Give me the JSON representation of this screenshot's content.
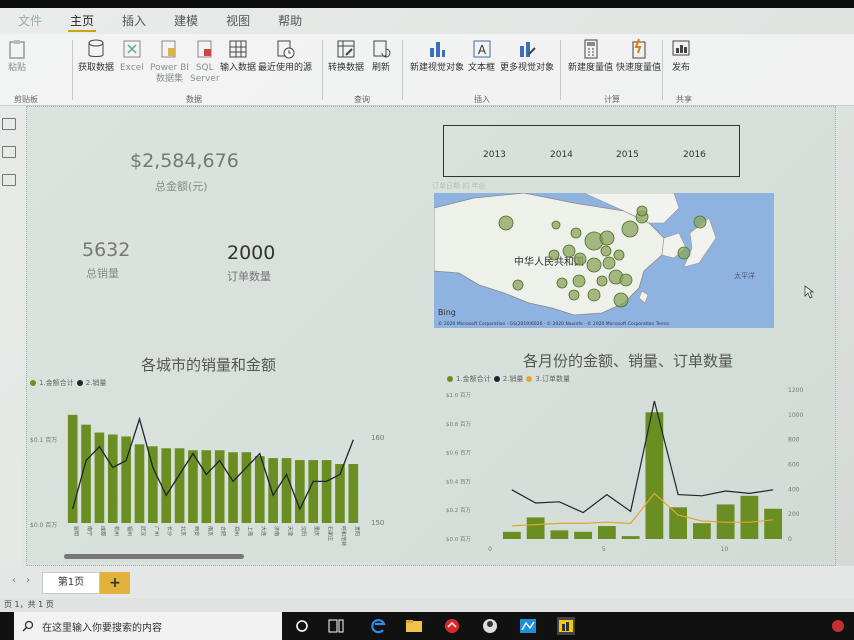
{
  "ribbon": {
    "tabs": [
      "文件",
      "主页",
      "插入",
      "建模",
      "视图",
      "帮助"
    ],
    "active_tab": "主页",
    "buttons": {
      "paste": "粘贴",
      "get_data": "获取数据",
      "excel": "Excel",
      "powerbi": "Power BI\n数据集",
      "sql": "SQL\nServer",
      "enter_data": "输入数据",
      "recent": "最近使用的源",
      "transform": "转换数据",
      "refresh": "刷新",
      "new_visual": "新建视觉对象",
      "textbox": "文本框",
      "more_visuals": "更多视觉对象",
      "new_measure": "新建度量值",
      "quick_measure": "快速度量值",
      "publish": "发布"
    },
    "groups": [
      "剪贴板",
      "数据",
      "查询",
      "插入",
      "计算",
      "共享"
    ]
  },
  "kpis": {
    "amount_value": "$2,584,676",
    "amount_label": "总金额(元)",
    "sales_value": "5632",
    "sales_label": "总销量",
    "orders_value": "2000",
    "orders_label": "订单数量"
  },
  "slicer": {
    "caption": "订单日期 的 年份",
    "years": [
      "2013",
      "2014",
      "2015",
      "2016"
    ]
  },
  "map": {
    "country_label": "中华人民共和国",
    "sea_label": "太平洋",
    "provider": "Bing",
    "copyright": "© 2020 Microsoft Corporation · GS(2019)6026 · © 2020 Navinfo · © 2020 Microsoft Corporation  Terms"
  },
  "left_chart_title": "各城市的销量和金额",
  "right_chart_title": "各月份的金额、销量、订单数量",
  "chart_data": [
    {
      "type": "bar",
      "title": "各城市的销量和金额",
      "series": [
        {
          "name": "1.金额合计",
          "values": [
            0.55,
            0.5,
            0.46,
            0.45,
            0.44,
            0.4,
            0.39,
            0.38,
            0.38,
            0.37,
            0.37,
            0.37,
            0.36,
            0.36,
            0.34,
            0.33,
            0.33,
            0.32,
            0.32,
            0.32,
            0.3,
            0.3
          ]
        },
        {
          "name": "2.销量",
          "values": [
            150,
            157,
            159,
            156,
            157,
            163,
            156,
            152,
            155,
            158,
            155,
            157,
            154,
            156,
            158,
            152,
            155,
            150,
            154,
            154,
            155,
            160
          ]
        }
      ],
      "y_ticks_left": [
        "$0.1 百万",
        "$0.0 百万"
      ],
      "y_ticks_right": [
        "160",
        "150"
      ],
      "city_labels": [
        "昆明",
        "南宁",
        "成都",
        "杭州",
        "福州",
        "武汉",
        "广州",
        "长沙",
        "北京",
        "西安",
        "南京",
        "合肥",
        "郑州",
        "上海",
        "大连",
        "济南",
        "天津",
        "沈阳",
        "重庆",
        "石家庄",
        "呼和浩特",
        "贵阳"
      ]
    },
    {
      "type": "bar",
      "title": "各月份的金额、销量、订单数量",
      "x": [
        1,
        2,
        3,
        4,
        5,
        6,
        7,
        8,
        9,
        10,
        11,
        12
      ],
      "series": [
        {
          "name": "1.金额合计",
          "values": [
            0.05,
            0.15,
            0.06,
            0.05,
            0.09,
            0.02,
            0.88,
            0.22,
            0.11,
            0.24,
            0.3,
            0.21
          ]
        },
        {
          "name": "2.销量",
          "values": [
            410,
            300,
            310,
            220,
            370,
            230,
            1150,
            370,
            360,
            400,
            380,
            410
          ]
        },
        {
          "name": "3.订单数量",
          "values": [
            110,
            120,
            130,
            130,
            140,
            130,
            380,
            200,
            150,
            140,
            140,
            160
          ]
        }
      ],
      "y_ticks_left": [
        "$1.0 百万",
        "$0.8 百万",
        "$0.6 百万",
        "$0.4 百万",
        "$0.2 百万",
        "$0.0 百万"
      ],
      "y_ticks_right": [
        "1200",
        "1000",
        "800",
        "600",
        "400",
        "200",
        "0"
      ],
      "x_ticks": [
        "0",
        "5",
        "10"
      ],
      "ylim_left": [
        0,
        1.0
      ],
      "ylim_right": [
        0,
        1200
      ]
    }
  ],
  "colors": {
    "bar": "#6b8e23",
    "bar_line": "#222233",
    "orders_line": "#e0a730",
    "accent": "#c8a515"
  },
  "sheet_tab": "第1页",
  "add_page": "+",
  "status": "页 1，共 1 页",
  "taskbar": {
    "search_placeholder": "在这里输入你要搜索的内容",
    "search_icon": "search-icon"
  }
}
